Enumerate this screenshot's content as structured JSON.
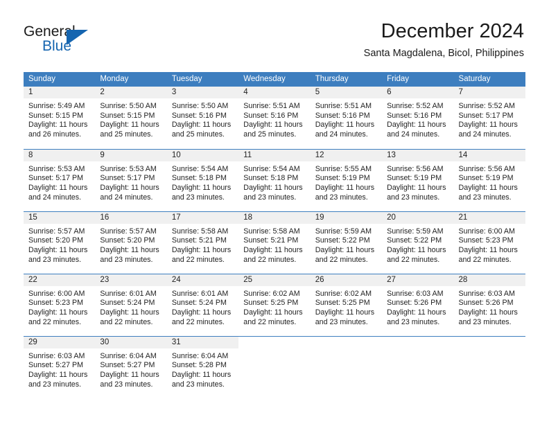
{
  "brand": {
    "name_top": "General",
    "name_bottom": "Blue",
    "triangle_icon": "triangle-icon",
    "accent_color": "#1565b0"
  },
  "header": {
    "title": "December 2024",
    "subtitle": "Santa Magdalena, Bicol, Philippines"
  },
  "theme": {
    "header_bg": "#3d7ebf",
    "header_text": "#ffffff",
    "daynum_band_bg": "#f0f0f0",
    "cell_bg": "#ffffff",
    "divider": "#3d7ebf",
    "body_text": "#222222"
  },
  "calendar": {
    "weekday_headers": [
      "Sunday",
      "Monday",
      "Tuesday",
      "Wednesday",
      "Thursday",
      "Friday",
      "Saturday"
    ],
    "labels": {
      "sunrise_prefix": "Sunrise:",
      "sunset_prefix": "Sunset:",
      "daylight_prefix": "Daylight:"
    },
    "weeks": [
      [
        {
          "day": "1",
          "sunrise": "Sunrise: 5:49 AM",
          "sunset": "Sunset: 5:15 PM",
          "daylight_line1": "Daylight: 11 hours",
          "daylight_line2": "and 26 minutes."
        },
        {
          "day": "2",
          "sunrise": "Sunrise: 5:50 AM",
          "sunset": "Sunset: 5:15 PM",
          "daylight_line1": "Daylight: 11 hours",
          "daylight_line2": "and 25 minutes."
        },
        {
          "day": "3",
          "sunrise": "Sunrise: 5:50 AM",
          "sunset": "Sunset: 5:16 PM",
          "daylight_line1": "Daylight: 11 hours",
          "daylight_line2": "and 25 minutes."
        },
        {
          "day": "4",
          "sunrise": "Sunrise: 5:51 AM",
          "sunset": "Sunset: 5:16 PM",
          "daylight_line1": "Daylight: 11 hours",
          "daylight_line2": "and 25 minutes."
        },
        {
          "day": "5",
          "sunrise": "Sunrise: 5:51 AM",
          "sunset": "Sunset: 5:16 PM",
          "daylight_line1": "Daylight: 11 hours",
          "daylight_line2": "and 24 minutes."
        },
        {
          "day": "6",
          "sunrise": "Sunrise: 5:52 AM",
          "sunset": "Sunset: 5:16 PM",
          "daylight_line1": "Daylight: 11 hours",
          "daylight_line2": "and 24 minutes."
        },
        {
          "day": "7",
          "sunrise": "Sunrise: 5:52 AM",
          "sunset": "Sunset: 5:17 PM",
          "daylight_line1": "Daylight: 11 hours",
          "daylight_line2": "and 24 minutes."
        }
      ],
      [
        {
          "day": "8",
          "sunrise": "Sunrise: 5:53 AM",
          "sunset": "Sunset: 5:17 PM",
          "daylight_line1": "Daylight: 11 hours",
          "daylight_line2": "and 24 minutes."
        },
        {
          "day": "9",
          "sunrise": "Sunrise: 5:53 AM",
          "sunset": "Sunset: 5:17 PM",
          "daylight_line1": "Daylight: 11 hours",
          "daylight_line2": "and 24 minutes."
        },
        {
          "day": "10",
          "sunrise": "Sunrise: 5:54 AM",
          "sunset": "Sunset: 5:18 PM",
          "daylight_line1": "Daylight: 11 hours",
          "daylight_line2": "and 23 minutes."
        },
        {
          "day": "11",
          "sunrise": "Sunrise: 5:54 AM",
          "sunset": "Sunset: 5:18 PM",
          "daylight_line1": "Daylight: 11 hours",
          "daylight_line2": "and 23 minutes."
        },
        {
          "day": "12",
          "sunrise": "Sunrise: 5:55 AM",
          "sunset": "Sunset: 5:19 PM",
          "daylight_line1": "Daylight: 11 hours",
          "daylight_line2": "and 23 minutes."
        },
        {
          "day": "13",
          "sunrise": "Sunrise: 5:56 AM",
          "sunset": "Sunset: 5:19 PM",
          "daylight_line1": "Daylight: 11 hours",
          "daylight_line2": "and 23 minutes."
        },
        {
          "day": "14",
          "sunrise": "Sunrise: 5:56 AM",
          "sunset": "Sunset: 5:19 PM",
          "daylight_line1": "Daylight: 11 hours",
          "daylight_line2": "and 23 minutes."
        }
      ],
      [
        {
          "day": "15",
          "sunrise": "Sunrise: 5:57 AM",
          "sunset": "Sunset: 5:20 PM",
          "daylight_line1": "Daylight: 11 hours",
          "daylight_line2": "and 23 minutes."
        },
        {
          "day": "16",
          "sunrise": "Sunrise: 5:57 AM",
          "sunset": "Sunset: 5:20 PM",
          "daylight_line1": "Daylight: 11 hours",
          "daylight_line2": "and 23 minutes."
        },
        {
          "day": "17",
          "sunrise": "Sunrise: 5:58 AM",
          "sunset": "Sunset: 5:21 PM",
          "daylight_line1": "Daylight: 11 hours",
          "daylight_line2": "and 22 minutes."
        },
        {
          "day": "18",
          "sunrise": "Sunrise: 5:58 AM",
          "sunset": "Sunset: 5:21 PM",
          "daylight_line1": "Daylight: 11 hours",
          "daylight_line2": "and 22 minutes."
        },
        {
          "day": "19",
          "sunrise": "Sunrise: 5:59 AM",
          "sunset": "Sunset: 5:22 PM",
          "daylight_line1": "Daylight: 11 hours",
          "daylight_line2": "and 22 minutes."
        },
        {
          "day": "20",
          "sunrise": "Sunrise: 5:59 AM",
          "sunset": "Sunset: 5:22 PM",
          "daylight_line1": "Daylight: 11 hours",
          "daylight_line2": "and 22 minutes."
        },
        {
          "day": "21",
          "sunrise": "Sunrise: 6:00 AM",
          "sunset": "Sunset: 5:23 PM",
          "daylight_line1": "Daylight: 11 hours",
          "daylight_line2": "and 22 minutes."
        }
      ],
      [
        {
          "day": "22",
          "sunrise": "Sunrise: 6:00 AM",
          "sunset": "Sunset: 5:23 PM",
          "daylight_line1": "Daylight: 11 hours",
          "daylight_line2": "and 22 minutes."
        },
        {
          "day": "23",
          "sunrise": "Sunrise: 6:01 AM",
          "sunset": "Sunset: 5:24 PM",
          "daylight_line1": "Daylight: 11 hours",
          "daylight_line2": "and 22 minutes."
        },
        {
          "day": "24",
          "sunrise": "Sunrise: 6:01 AM",
          "sunset": "Sunset: 5:24 PM",
          "daylight_line1": "Daylight: 11 hours",
          "daylight_line2": "and 22 minutes."
        },
        {
          "day": "25",
          "sunrise": "Sunrise: 6:02 AM",
          "sunset": "Sunset: 5:25 PM",
          "daylight_line1": "Daylight: 11 hours",
          "daylight_line2": "and 22 minutes."
        },
        {
          "day": "26",
          "sunrise": "Sunrise: 6:02 AM",
          "sunset": "Sunset: 5:25 PM",
          "daylight_line1": "Daylight: 11 hours",
          "daylight_line2": "and 23 minutes."
        },
        {
          "day": "27",
          "sunrise": "Sunrise: 6:03 AM",
          "sunset": "Sunset: 5:26 PM",
          "daylight_line1": "Daylight: 11 hours",
          "daylight_line2": "and 23 minutes."
        },
        {
          "day": "28",
          "sunrise": "Sunrise: 6:03 AM",
          "sunset": "Sunset: 5:26 PM",
          "daylight_line1": "Daylight: 11 hours",
          "daylight_line2": "and 23 minutes."
        }
      ],
      [
        {
          "day": "29",
          "sunrise": "Sunrise: 6:03 AM",
          "sunset": "Sunset: 5:27 PM",
          "daylight_line1": "Daylight: 11 hours",
          "daylight_line2": "and 23 minutes."
        },
        {
          "day": "30",
          "sunrise": "Sunrise: 6:04 AM",
          "sunset": "Sunset: 5:27 PM",
          "daylight_line1": "Daylight: 11 hours",
          "daylight_line2": "and 23 minutes."
        },
        {
          "day": "31",
          "sunrise": "Sunrise: 6:04 AM",
          "sunset": "Sunset: 5:28 PM",
          "daylight_line1": "Daylight: 11 hours",
          "daylight_line2": "and 23 minutes."
        },
        {
          "day": "",
          "sunrise": "",
          "sunset": "",
          "daylight_line1": "",
          "daylight_line2": ""
        },
        {
          "day": "",
          "sunrise": "",
          "sunset": "",
          "daylight_line1": "",
          "daylight_line2": ""
        },
        {
          "day": "",
          "sunrise": "",
          "sunset": "",
          "daylight_line1": "",
          "daylight_line2": ""
        },
        {
          "day": "",
          "sunrise": "",
          "sunset": "",
          "daylight_line1": "",
          "daylight_line2": ""
        }
      ]
    ]
  }
}
